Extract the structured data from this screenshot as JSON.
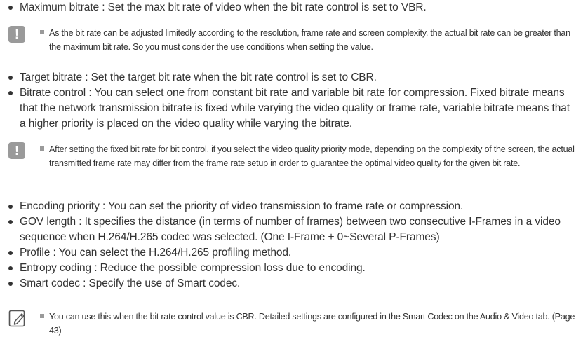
{
  "bullets": [
    "Maximum bitrate : Set the max bit rate of video when the bit rate control is set to VBR.",
    "Target bitrate : Set the target bit rate when the bit rate control is set to CBR.",
    "Bitrate control : You can select one from constant bit rate and variable bit rate for compression. Fixed bitrate means that the network transmission bitrate is fixed while varying the video quality or frame rate, variable bitrate means that a higher priority is placed on the video quality while varying the bitrate.",
    "Encoding priority : You can set the priority of video transmission to frame rate or compression.",
    "GOV length : It specifies the distance (in terms of number of frames) between two consecutive I-Frames in a video sequence when H.264/H.265 codec was selected. (One I-Frame + 0~Several P-Frames)",
    "Profile : You can select the H.264/H.265 profiling method.",
    "Entropy coding : Reduce the possible compression loss due to encoding.",
    "Smart codec : Specify the use of Smart codec."
  ],
  "notes": [
    {
      "icon": "caution-icon",
      "text": "As the bit rate can be adjusted limitedly according to the resolution, frame rate and screen complexity, the actual bit rate can be greater than the maximum bit rate. So you must consider the use conditions when setting the value."
    },
    {
      "icon": "caution-icon",
      "text": "After setting the fixed bit rate for bit control, if you select the video quality priority mode, depending on the complexity of the screen, the actual transmitted frame rate may differ from the frame rate setup in order to guarantee the optimal video quality for the given bit rate."
    },
    {
      "icon": "memo-pencil-icon",
      "text": "You can use this when the bit rate control value is CBR. Detailed settings are configured in the Smart Codec on the Audio & Video tab. (Page 43)"
    }
  ],
  "colors": {
    "text": "#333333",
    "icon_gray": "#9a9a9a"
  }
}
